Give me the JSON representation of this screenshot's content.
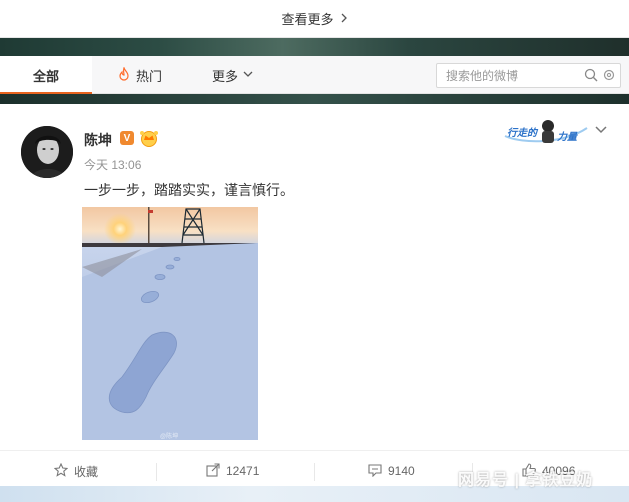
{
  "top": {
    "more_label": "查看更多"
  },
  "tabs": [
    {
      "label": "全部"
    },
    {
      "label": "热门"
    },
    {
      "label": "更多"
    }
  ],
  "search": {
    "placeholder": "搜索他的微博"
  },
  "post": {
    "author": "陈坤",
    "time": "今天 13:06",
    "text": "一步一步，踏踏实实，谨言慎行。",
    "verified": "V",
    "badge_text": "行走的力量",
    "photo_watermark": "@陈坤"
  },
  "actions": {
    "favorite_label": "收藏",
    "forward_count": "12471",
    "comment_count": "9140",
    "like_count": "40096"
  },
  "watermark": "网易号 | 拿铁豆奶",
  "colors": {
    "accent": "#e8631f",
    "verified": "#f0892f",
    "text": "#333333",
    "muted": "#939393"
  },
  "icons": [
    "chevron-right-icon",
    "fire-icon",
    "chevron-down-icon",
    "search-icon",
    "gear-icon",
    "crown-icon",
    "star-icon",
    "forward-icon",
    "comment-icon",
    "like-icon"
  ]
}
